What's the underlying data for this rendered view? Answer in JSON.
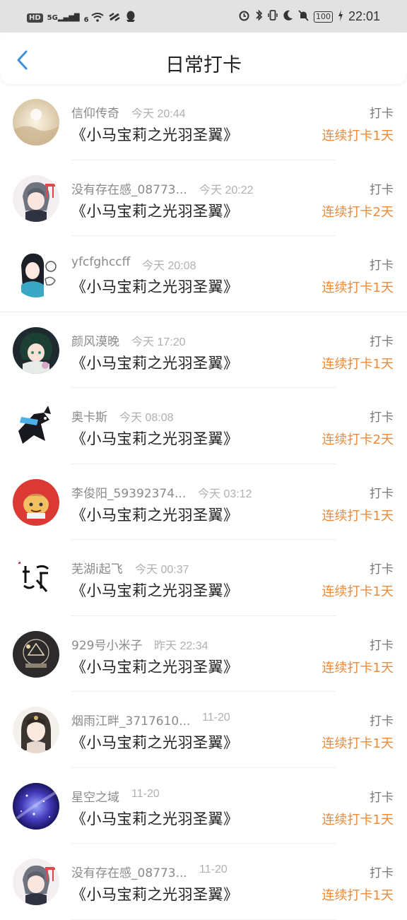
{
  "status_bar": {
    "left_icons": [
      "hd-icon",
      "5g-signal-icon",
      "wifi-icon",
      "link-icon",
      "qq-icon"
    ],
    "hd": "HD",
    "net": "5G",
    "wifi_badge": "6",
    "battery": "100",
    "time": "22:01"
  },
  "header": {
    "title": "日常打卡",
    "back_icon": "chevron-left-icon"
  },
  "colors": {
    "accent": "#ec8a3a",
    "back": "#3d8fe0",
    "statusbar_bg": "#e2e2e2"
  },
  "items": [
    {
      "name": "信仰传奇",
      "time": "今天 20:44",
      "book": "《小马宝莉之光羽圣翼》",
      "action": "打卡",
      "streak": "连续打卡1天"
    },
    {
      "name": "没有存在感_08773...",
      "time": "今天 20:22",
      "book": "《小马宝莉之光羽圣翼》",
      "action": "打卡",
      "streak": "连续打卡2天"
    },
    {
      "name": "yfcfghccff",
      "time": "今天 20:08",
      "book": "《小马宝莉之光羽圣翼》",
      "action": "打卡",
      "streak": "连续打卡1天"
    },
    {
      "name": "颜风漠晚",
      "time": "今天 17:20",
      "book": "《小马宝莉之光羽圣翼》",
      "action": "打卡",
      "streak": "连续打卡1天"
    },
    {
      "name": "奥卡斯",
      "time": "今天 08:08",
      "book": "《小马宝莉之光羽圣翼》",
      "action": "打卡",
      "streak": "连续打卡2天"
    },
    {
      "name": "李俊阳_59392374...",
      "time": "今天 03:12",
      "book": "《小马宝莉之光羽圣翼》",
      "action": "打卡",
      "streak": "连续打卡1天"
    },
    {
      "name": "芜湖i起飞",
      "time": "今天 00:37",
      "book": "《小马宝莉之光羽圣翼》",
      "action": "打卡",
      "streak": "连续打卡1天"
    },
    {
      "name": "929号小米子",
      "time": "昨天 22:34",
      "book": "《小马宝莉之光羽圣翼》",
      "action": "打卡",
      "streak": "连续打卡1天"
    },
    {
      "name": "烟雨江畔_3717610...",
      "time": "11-20",
      "book": "《小马宝莉之光羽圣翼》",
      "action": "打卡",
      "streak": "连续打卡1天"
    },
    {
      "name": "星空之域",
      "time": "11-20",
      "book": "《小马宝莉之光羽圣翼》",
      "action": "打卡",
      "streak": "连续打卡1天"
    },
    {
      "name": "没有存在感_08773...",
      "time": "11-20",
      "book": "《小马宝莉之光羽圣翼》",
      "action": "打卡",
      "streak": "连续打卡1天"
    }
  ],
  "avatars": [
    "light-watercolor",
    "anime-girl-gray",
    "anime-girl-scarf",
    "anime-boy-green",
    "black-cat-blue",
    "red-cartoon",
    "calligraphy",
    "dark-emblem",
    "anime-girl-light",
    "galaxy",
    "anime-girl-gray"
  ]
}
